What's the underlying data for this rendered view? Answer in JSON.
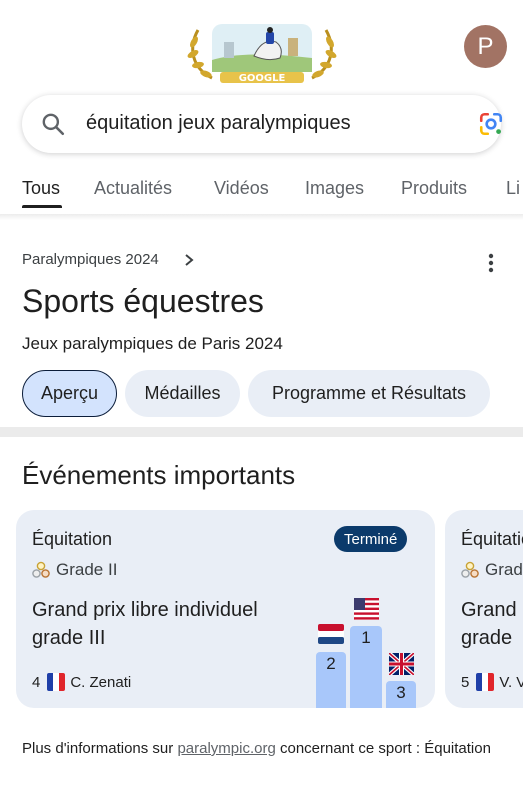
{
  "header": {
    "doodle_text": "GOOGLE",
    "avatar_letter": "P"
  },
  "search": {
    "query": "équitation jeux paralympiques"
  },
  "tabs": [
    {
      "label": "Tous",
      "active": true
    },
    {
      "label": "Actualités"
    },
    {
      "label": "Vidéos"
    },
    {
      "label": "Images"
    },
    {
      "label": "Produits"
    },
    {
      "label": "Li"
    }
  ],
  "panel": {
    "breadcrumb": "Paralympiques 2024",
    "title": "Sports équestres",
    "subtitle": "Jeux paralympiques de Paris 2024",
    "chips": [
      {
        "label": "Aperçu",
        "selected": true
      },
      {
        "label": "Médailles"
      },
      {
        "label": "Programme et Résultats"
      }
    ]
  },
  "events": {
    "heading": "Événements importants",
    "cards": [
      {
        "sport": "Équitation",
        "grade": "Grade II",
        "status": "Terminé",
        "event": "Grand prix libre individuel grade III",
        "rank": "4",
        "athlete": "C. Zenati",
        "podium": [
          {
            "place": "1",
            "flag": "USA"
          },
          {
            "place": "2",
            "flag": "Netherlands"
          },
          {
            "place": "3",
            "flag": "United Kingdom"
          }
        ]
      },
      {
        "sport": "Équitatio",
        "grade": "Grad",
        "event_line1": "Grand",
        "event_line2": "grade",
        "rank": "5",
        "athlete": "V. V"
      }
    ]
  },
  "footer": {
    "prefix": "Plus d'informations sur ",
    "link": "paralympic.org",
    "suffix": " concernant ce sport : Équitation"
  },
  "colors": {
    "chip_bg": "#e9eef6",
    "chip_selected_bg": "#d3e3fd",
    "badge_bg": "#0b3a6b",
    "podium": "#a8c7fa",
    "avatar": "#a27364"
  }
}
